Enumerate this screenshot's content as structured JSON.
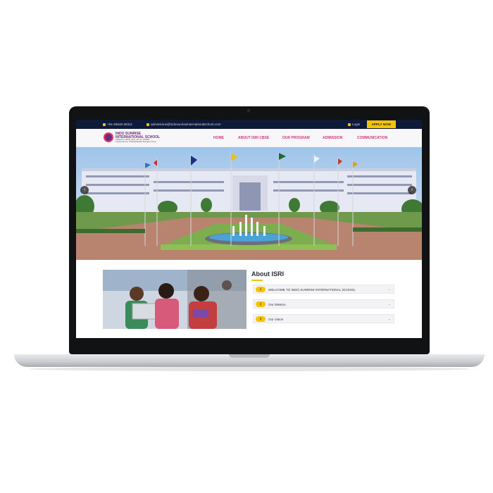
{
  "topbar": {
    "phone": "+91-63646-36311",
    "email": "admissions@indosunriseinternationalschool.com",
    "login": "Login",
    "apply": "APPLY NOW"
  },
  "logo": {
    "line1": "INDO SUNRISE",
    "line2": "INTERNATIONAL SCHOOL",
    "line3": "Affiliated to CBSE, Delhi, Affl. No. 830598",
    "line4": "Kothanur(Post), Chikkabettahalli, Bangalore Rural"
  },
  "nav": {
    "items": [
      "HOME",
      "ABOUT ISRI CBSE",
      "OUR PROGRAM",
      "ADMISSION",
      "COMMUNICATION"
    ]
  },
  "hero": {
    "prev": "‹",
    "next": "›"
  },
  "about": {
    "title": "About ISRI",
    "items": [
      {
        "num": "1",
        "label": "WELCOME TO INDO SUNRISE INTERNATIONAL SCHOOL"
      },
      {
        "num": "2",
        "label": "Our Mission"
      },
      {
        "num": "3",
        "label": "Our Vision"
      }
    ]
  },
  "colors": {
    "topbar": "#0e1a3c",
    "accent_yellow": "#f5c400",
    "nav_pink": "#d9337e",
    "brand_purple": "#6e2b79"
  }
}
